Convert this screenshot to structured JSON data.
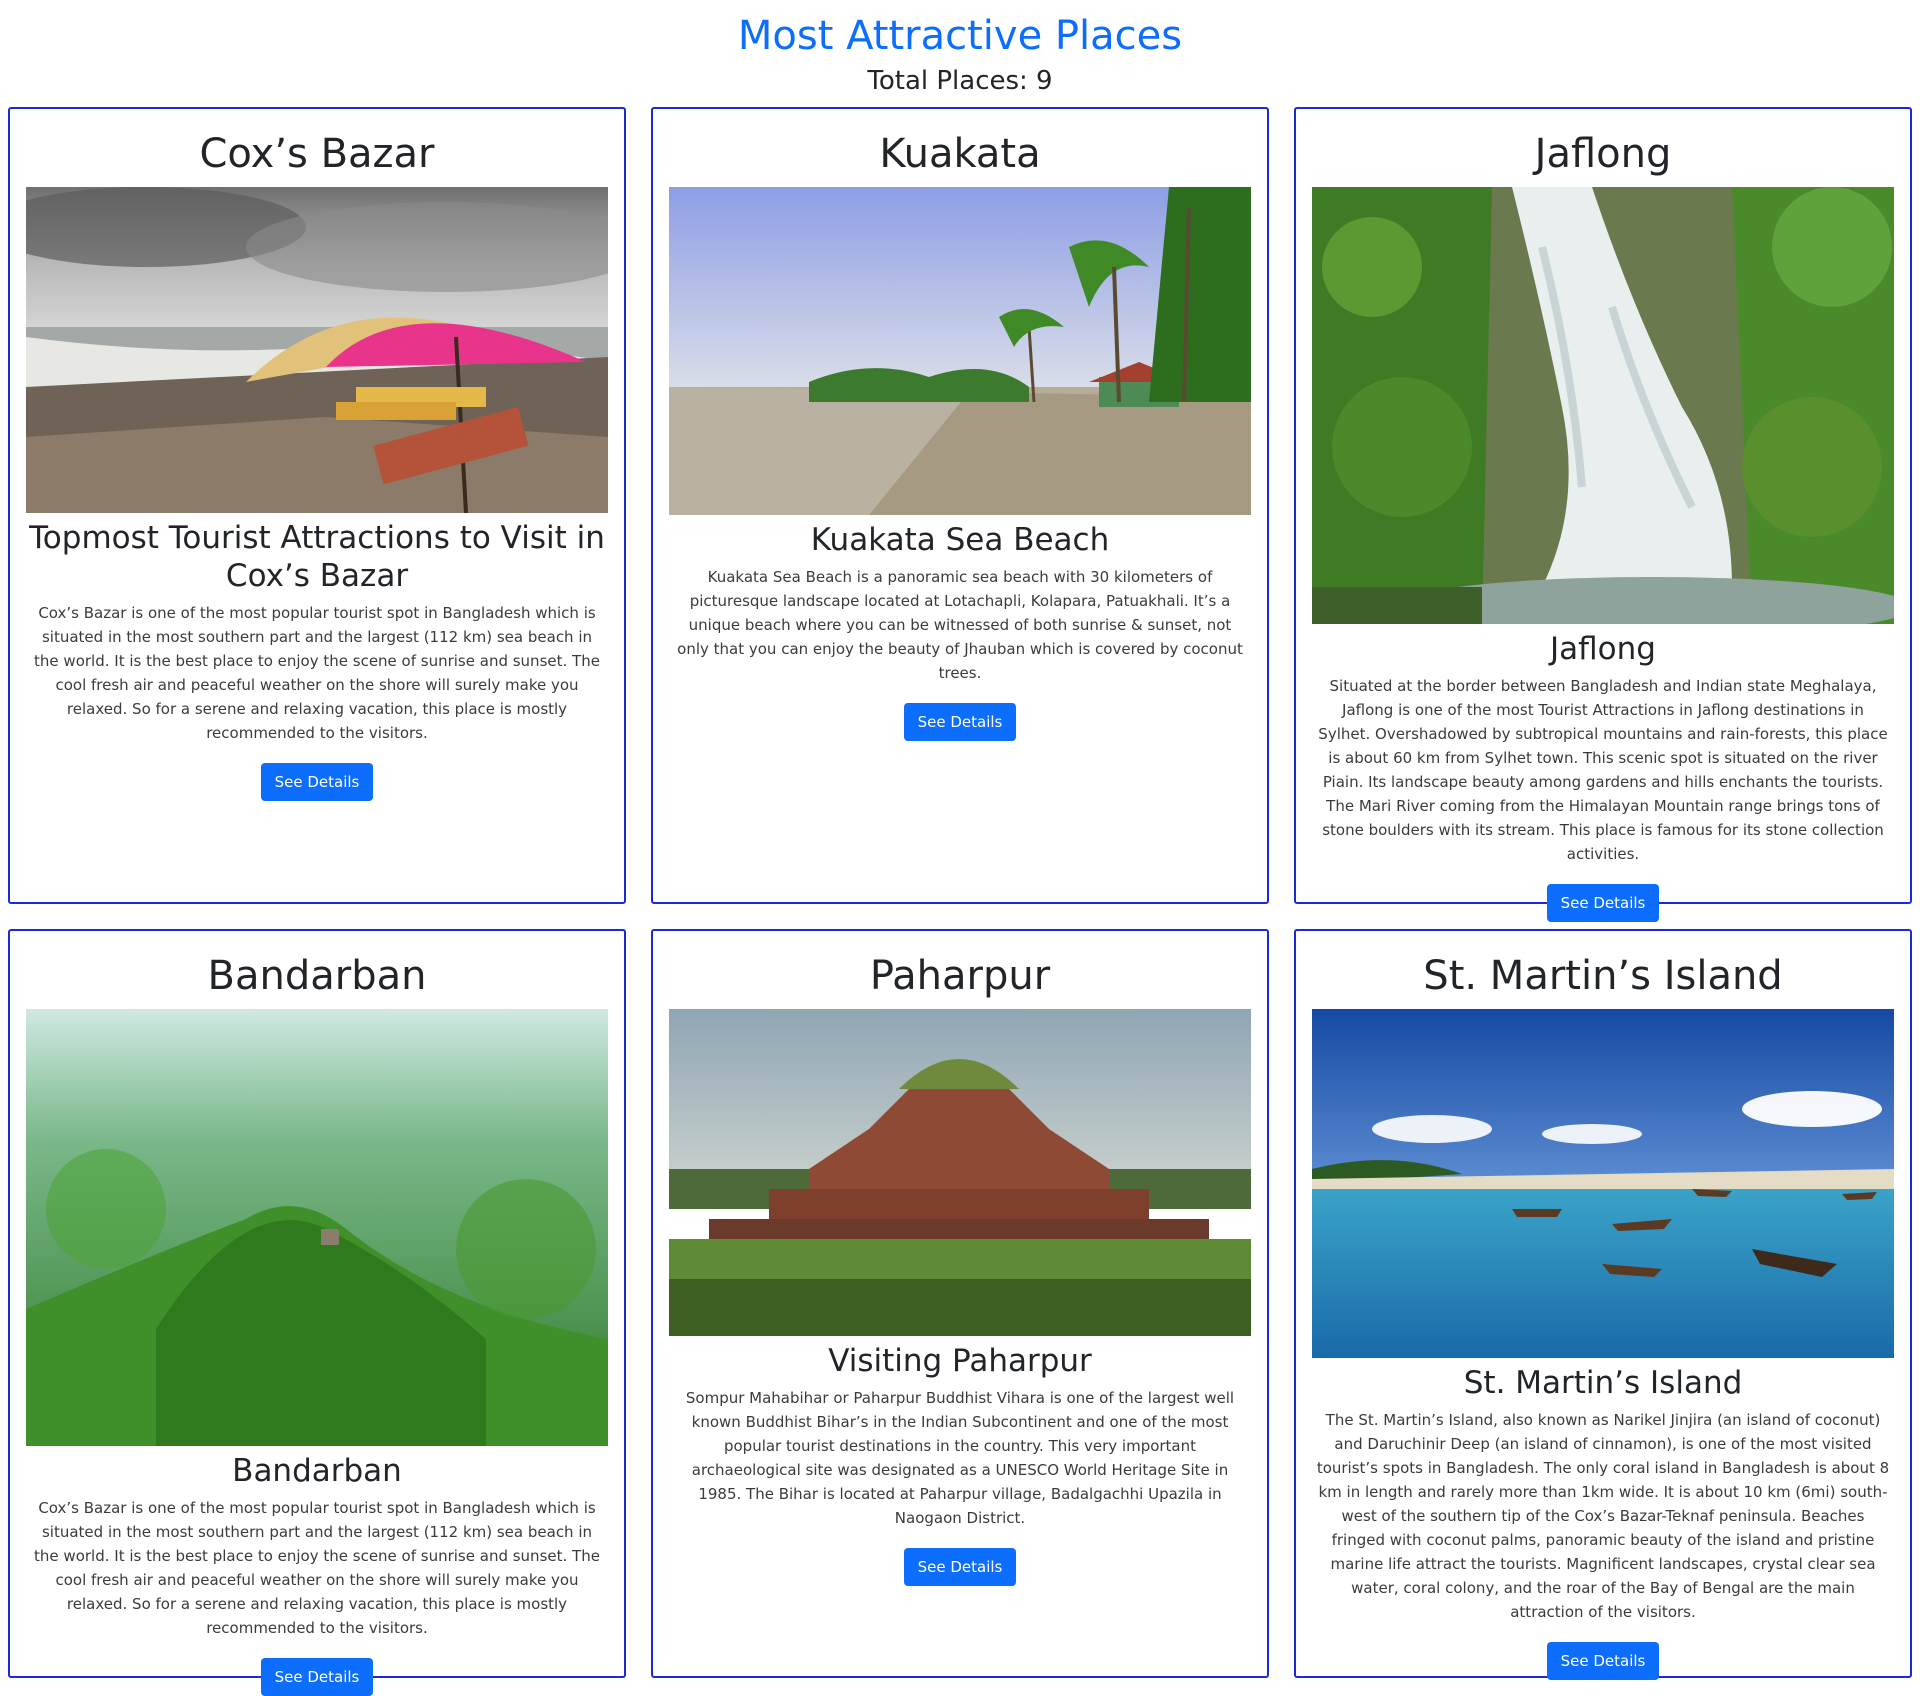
{
  "page": {
    "title": "Most Attractive Places",
    "total_label": "Total Places: 9",
    "accent_color": "#0d6efd",
    "card_border_color": "#1a2bd6"
  },
  "cards": [
    {
      "name": "Cox’s Bazar",
      "heading": "Topmost Tourist Attractions to Visit in Cox’s Bazar",
      "text": "Cox’s Bazar is one of the most popular tourist spot in Bangladesh which is situated in the most southern part and the largest (112 km) sea beach in the world. It is the best place to enjoy the scene of sunrise and sunset. The cool fresh air and peaceful weather on the shore will surely make you relaxed. So for a serene and relaxing vacation, this place is mostly recommended to the visitors.",
      "button": "See Details",
      "image": "beach-with-umbrellas"
    },
    {
      "name": "Kuakata",
      "heading": "Kuakata Sea Beach",
      "text": "Kuakata Sea Beach is a panoramic sea beach with 30 kilometers of picturesque landscape located at Lotachapli, Kolapara, Patuakhali. It’s a unique beach where you can be witnessed of both sunrise & sunset, not only that you can enjoy the beauty of Jhauban which is covered by coconut trees.",
      "button": "See Details",
      "image": "beach-with-palm-trees"
    },
    {
      "name": "Jaflong",
      "heading": "Jaflong",
      "text": "Situated at the border between Bangladesh and Indian state Meghalaya, Jaflong is one of the most Tourist Attractions in Jaflong destinations in Sylhet. Overshadowed by subtropical mountains and rain-forests, this place is about 60 km from Sylhet town. This scenic spot is situated on the river Piain. Its landscape beauty among gardens and hills enchants the tourists. The Mari River coming from the Himalayan Mountain range brings tons of stone boulders with its stream. This place is famous for its stone collection activities.",
      "button": "See Details",
      "image": "waterfall-in-forest"
    },
    {
      "name": "Bandarban",
      "heading": "Bandarban",
      "text": "Cox’s Bazar is one of the most popular tourist spot in Bangladesh which is situated in the most southern part and the largest (112 km) sea beach in the world. It is the best place to enjoy the scene of sunrise and sunset. The cool fresh air and peaceful weather on the shore will surely make you relaxed. So for a serene and relaxing vacation, this place is mostly recommended to the visitors.",
      "button": "See Details",
      "image": "green-hills"
    },
    {
      "name": "Paharpur",
      "heading": "Visiting Paharpur",
      "text": "Sompur Mahabihar or Paharpur Buddhist Vihara is one of the largest well known Buddhist Bihar’s in the Indian Subcontinent and one of the most popular tourist destinations in the country. This very important archaeological site was designated as a UNESCO World Heritage Site in 1985. The Bihar is located at Paharpur village, Badalgachhi Upazila in Naogaon District.",
      "button": "See Details",
      "image": "brick-monastery-ruins"
    },
    {
      "name": "St. Martin’s Island",
      "heading": "St. Martin’s Island",
      "text": "The St. Martin’s Island, also known as Narikel Jinjira (an island of coconut) and Daruchinir Deep (an island of cinnamon), is one of the most visited tourist’s spots in Bangladesh. The only coral island in Bangladesh is about 8 km in length and rarely more than 1km wide. It is about 10 km (6mi) south-west of the southern tip of the Cox’s Bazar-Teknaf peninsula. Beaches fringed with coconut palms, panoramic beauty of the island and pristine marine life attract the tourists. Magnificent landscapes, crystal clear sea water, coral colony, and the roar of the Bay of Bengal are the main attraction of the visitors.",
      "button": "See Details",
      "image": "blue-sea-with-boats"
    }
  ]
}
